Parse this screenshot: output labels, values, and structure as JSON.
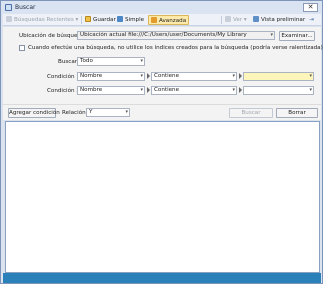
{
  "window": {
    "title": "Buscar"
  },
  "toolbar": {
    "search_docs": "Búsquedas Recientes",
    "save": "Guardar",
    "simple": "Simple",
    "advanced": "Avanzada",
    "view": "Ver",
    "preview": "Vista preliminar"
  },
  "form": {
    "location_label": "Ubicación de búsqueda:",
    "location_value": "Ubicación actual file:///C:/Users/user/Documents/My Library",
    "browse_button": "Examinar...",
    "no_index_checkbox": "Cuando efectúe una búsqueda, no utilice los índices creados para la búsqueda (podría verse ralentizada)",
    "search_label": "Buscar:",
    "search_value": "Todo",
    "cond1_label": "Condición 1:",
    "cond1_field": "Nombre",
    "cond1_op": "Contiene",
    "cond1_value": "",
    "cond2_label": "Condición 2:",
    "cond2_field": "Nombre",
    "cond2_op": "Contiene",
    "cond2_value": "",
    "add_condition": "Agregar condición",
    "relation_label": "Relación:",
    "relation_value": "Y",
    "search_button": "Buscar",
    "clear_button": "Borrar"
  },
  "colors": {
    "accent": "#2a80b9",
    "highlight": "#fde9a9",
    "active_input": "#fdf5b9"
  }
}
